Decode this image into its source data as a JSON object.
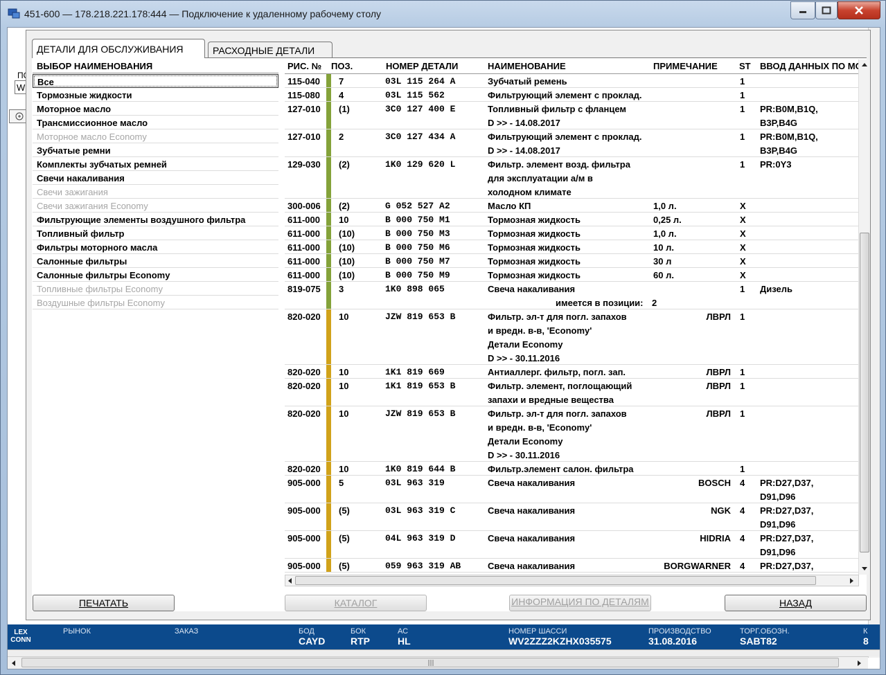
{
  "window": {
    "title": "451-600 — 178.218.221.178:444 — Подключение к удаленному рабочему столу"
  },
  "bg": {
    "label1": "ПО",
    "label2": "W"
  },
  "tabs": [
    {
      "label": "ДЕТАЛИ ДЛЯ ОБСЛУЖИВАНИЯ"
    },
    {
      "label": "РАСХОДНЫЕ ДЕТАЛИ"
    }
  ],
  "left": {
    "header": "ВЫБОР НАИМЕНОВАНИЯ",
    "items": [
      {
        "label": "Все",
        "state": "selected"
      },
      {
        "label": "Тормозные жидкости",
        "state": "enabled"
      },
      {
        "label": "Моторное масло",
        "state": "enabled"
      },
      {
        "label": "Трансмиссионное масло",
        "state": "enabled"
      },
      {
        "label": "Моторное масло Economy",
        "state": "disabled"
      },
      {
        "label": "Зубчатые ремни",
        "state": "enabled"
      },
      {
        "label": "Комплекты зубчатых ремней",
        "state": "enabled"
      },
      {
        "label": "Свечи накаливания",
        "state": "enabled"
      },
      {
        "label": "Свечи зажигания",
        "state": "disabled"
      },
      {
        "label": "Свечи зажигания Economy",
        "state": "disabled"
      },
      {
        "label": "Фильтрующие элементы воздушного фильтра",
        "state": "enabled"
      },
      {
        "label": "Топливный фильтр",
        "state": "enabled"
      },
      {
        "label": "Фильтры моторного масла",
        "state": "enabled"
      },
      {
        "label": "Салонные фильтры",
        "state": "enabled"
      },
      {
        "label": "Салонные фильтры Economy",
        "state": "enabled"
      },
      {
        "label": "Топливные фильтры Economy",
        "state": "disabled"
      },
      {
        "label": "Воздушные фильтры Economy",
        "state": "disabled"
      }
    ]
  },
  "grid": {
    "headers": {
      "fig": "РИС. №",
      "pos": "ПОЗ.",
      "part": "НОМЕР ДЕТАЛИ",
      "name": "НАИМЕНОВАНИЕ",
      "note": "ПРИМЕЧАНИЕ",
      "st": "ST",
      "input": "ВВОД ДАННЫХ ПО МО"
    },
    "colors": {
      "green": "#84a23a",
      "yellow": "#d1a21a"
    },
    "rows": [
      {
        "fig": "115-040",
        "pos": "7",
        "part": "03L  115  264  A",
        "names": [
          "Зубчатый ремень"
        ],
        "note": "",
        "st": "1",
        "input": [],
        "color": "green"
      },
      {
        "fig": "115-080",
        "pos": "4",
        "part": "03L  115  562",
        "names": [
          "Фильтрующий элемент с проклад."
        ],
        "note": "",
        "st": "1",
        "input": [],
        "color": "green"
      },
      {
        "fig": "127-010",
        "pos": "(1)",
        "part": "3C0  127  400  E",
        "names": [
          "Топливный фильтр с фланцем",
          "D            >> - 14.08.2017"
        ],
        "note": "",
        "st": "1",
        "input": [
          "PR:B0M,B1Q,",
          "B3P,B4G"
        ],
        "color": "green"
      },
      {
        "fig": "127-010",
        "pos": "2",
        "part": "3C0  127  434  A",
        "names": [
          "Фильтрующий элемент с проклад.",
          "D            >> - 14.08.2017"
        ],
        "note": "",
        "st": "1",
        "input": [
          "PR:B0M,B1Q,",
          "B3P,B4G"
        ],
        "color": "green"
      },
      {
        "fig": "129-030",
        "pos": "(2)",
        "part": "1K0  129  620  L",
        "names": [
          "Фильтр. элемент возд. фильтра",
          "для эксплуатации а/м в",
          "холодном климате"
        ],
        "note": "",
        "st": "1",
        "input": [
          "PR:0Y3"
        ],
        "color": "green"
      },
      {
        "fig": "300-006",
        "pos": "(2)",
        "part": "G    052  527  A2",
        "names": [
          "Масло КП"
        ],
        "note": "1,0 л.",
        "st": "X",
        "input": [],
        "color": "green"
      },
      {
        "fig": "611-000",
        "pos": "10",
        "part": "B    000  750  M1",
        "names": [
          "Тормозная жидкость"
        ],
        "note": "0,25 л.",
        "st": "X",
        "input": [],
        "color": "green"
      },
      {
        "fig": "611-000",
        "pos": "(10)",
        "part": "B    000  750  M3",
        "names": [
          "Тормозная жидкость"
        ],
        "note": "1,0 л.",
        "st": "X",
        "input": [],
        "color": "green"
      },
      {
        "fig": "611-000",
        "pos": "(10)",
        "part": "B    000  750  M6",
        "names": [
          "Тормозная жидкость"
        ],
        "note": "10 л.",
        "st": "X",
        "input": [],
        "color": "green"
      },
      {
        "fig": "611-000",
        "pos": "(10)",
        "part": "B    000  750  M7",
        "names": [
          "Тормозная жидкость"
        ],
        "note": "30 л",
        "st": "X",
        "input": [],
        "color": "green"
      },
      {
        "fig": "611-000",
        "pos": "(10)",
        "part": "B    000  750  M9",
        "names": [
          "Тормозная жидкость"
        ],
        "note": "60 л.",
        "st": "X",
        "input": [],
        "color": "green"
      },
      {
        "fig": "819-075",
        "pos": "3",
        "part": "1K0  898  065",
        "names": [
          "Свеча накаливания"
        ],
        "note": "",
        "st": "1",
        "input": [
          "Дизель"
        ],
        "color": "green",
        "extra": {
          "label": "имеется в позиции:",
          "value": "2"
        }
      },
      {
        "fig": "820-020",
        "pos": "10",
        "part": "JZW  819  653  B",
        "names": [
          "Фильтр. эл-т для погл. запахов",
          "и вредн. в-в,  'Economy'",
          "Детали Economy",
          "D            >> - 30.11.2016"
        ],
        "note": "ЛВРЛ",
        "st": "1",
        "input": [],
        "color": "yellow"
      },
      {
        "fig": "820-020",
        "pos": "10",
        "part": "1K1  819  669",
        "names": [
          "Антиаллерг. фильтр, погл. зап."
        ],
        "note": "ЛВРЛ",
        "st": "1",
        "input": [],
        "color": "yellow"
      },
      {
        "fig": "820-020",
        "pos": "10",
        "part": "1K1  819  653  B",
        "names": [
          "Фильтр. элемент, поглощающий",
          "запахи и вредные вещества"
        ],
        "note": "ЛВРЛ",
        "st": "1",
        "input": [],
        "color": "yellow"
      },
      {
        "fig": "820-020",
        "pos": "10",
        "part": "JZW  819  653  B",
        "names": [
          "Фильтр. эл-т для погл. запахов",
          "и вредн. в-в,  'Economy'",
          "Детали Economy",
          "D            >> - 30.11.2016"
        ],
        "note": "ЛВРЛ",
        "st": "1",
        "input": [],
        "color": "yellow"
      },
      {
        "fig": "820-020",
        "pos": "10",
        "part": "1K0  819  644  B",
        "names": [
          "Фильтр.элемент салон. фильтра"
        ],
        "note": "",
        "st": "1",
        "input": [],
        "color": "yellow"
      },
      {
        "fig": "905-000",
        "pos": "5",
        "part": "03L  963  319",
        "names": [
          "Свеча накаливания"
        ],
        "note": "BOSCH",
        "st": "4",
        "input": [
          "PR:D27,D37,",
          "D91,D96"
        ],
        "color": "yellow"
      },
      {
        "fig": "905-000",
        "pos": "(5)",
        "part": "03L  963  319  C",
        "names": [
          "Свеча накаливания"
        ],
        "note": "NGK",
        "st": "4",
        "input": [
          "PR:D27,D37,",
          "D91,D96"
        ],
        "color": "yellow"
      },
      {
        "fig": "905-000",
        "pos": "(5)",
        "part": "04L  963  319  D",
        "names": [
          "Свеча накаливания"
        ],
        "note": "HIDRIA",
        "st": "4",
        "input": [
          "PR:D27,D37,",
          "D91,D96"
        ],
        "color": "yellow"
      },
      {
        "fig": "905-000",
        "pos": "(5)",
        "part": "059  963  319  AB",
        "names": [
          "Свеча накаливания"
        ],
        "note": "BORGWARNER",
        "st": "4",
        "input": [
          "PR:D27,D37,"
        ],
        "color": "yellow"
      }
    ]
  },
  "buttons": {
    "print": "ПЕЧАТАТЬ",
    "catalog": "КАТАЛОГ",
    "info": "ИНФОРМАЦИЯ ПО ДЕТАЛЯМ",
    "back": "НАЗАД"
  },
  "status": {
    "logo": "LEX CONN",
    "market_label": "РЫНОК",
    "order_label": "ЗАКАЗ",
    "bod_label": "БОД",
    "bod": "CAYD",
    "bok_label": "БОК",
    "bok": "RTP",
    "ac_label": "АС",
    "ac": "HL",
    "chassis_label": "НОМЕР ШАССИ",
    "chassis": "WV2ZZZ2KZHX035575",
    "prod_label": "ПРОИЗВОДСТВО",
    "prod": "31.08.2016",
    "trade_label": "ТОРГ.ОБОЗН.",
    "trade": "SABT82",
    "k_label": "К",
    "k": "8"
  }
}
